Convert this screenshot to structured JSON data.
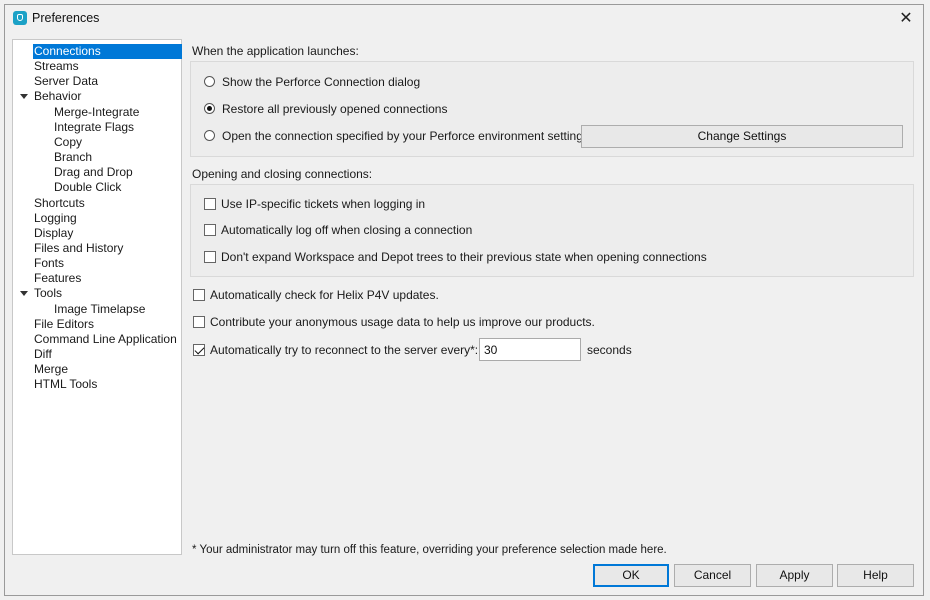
{
  "window": {
    "title": "Preferences",
    "close_glyph": "✕"
  },
  "sidebar": {
    "items": [
      {
        "label": "Connections",
        "level": 0,
        "selected": true
      },
      {
        "label": "Streams",
        "level": 0
      },
      {
        "label": "Server Data",
        "level": 0
      },
      {
        "label": "Behavior",
        "level": 0,
        "expanded": true
      },
      {
        "label": "Merge-Integrate",
        "level": 1
      },
      {
        "label": "Integrate Flags",
        "level": 1
      },
      {
        "label": "Copy",
        "level": 1
      },
      {
        "label": "Branch",
        "level": 1
      },
      {
        "label": "Drag and Drop",
        "level": 1
      },
      {
        "label": "Double Click",
        "level": 1
      },
      {
        "label": "Shortcuts",
        "level": 0
      },
      {
        "label": "Logging",
        "level": 0
      },
      {
        "label": "Display",
        "level": 0
      },
      {
        "label": "Files and History",
        "level": 0
      },
      {
        "label": "Fonts",
        "level": 0
      },
      {
        "label": "Features",
        "level": 0
      },
      {
        "label": "Tools",
        "level": 0,
        "expanded": true
      },
      {
        "label": "Image Timelapse",
        "level": 1
      },
      {
        "label": "File Editors",
        "level": 0
      },
      {
        "label": "Command Line Application",
        "level": 0
      },
      {
        "label": "Diff",
        "level": 0
      },
      {
        "label": "Merge",
        "level": 0
      },
      {
        "label": "HTML Tools",
        "level": 0
      }
    ]
  },
  "launch": {
    "heading": "When the application launches:",
    "options": [
      {
        "label": "Show the Perforce Connection dialog",
        "checked": false
      },
      {
        "label": "Restore all previously opened connections",
        "checked": true
      },
      {
        "label": "Open the connection specified by your Perforce environment settings",
        "checked": false
      }
    ],
    "change_settings_label": "Change Settings"
  },
  "opening": {
    "heading": "Opening and closing connections:",
    "options": [
      {
        "label": "Use IP-specific tickets when logging in",
        "checked": false
      },
      {
        "label": "Automatically log off when closing a connection",
        "checked": false
      },
      {
        "label": "Don't expand Workspace and Depot trees to their previous state when opening connections",
        "checked": false
      }
    ]
  },
  "general": {
    "auto_check_updates_label": "Automatically check for Helix P4V updates.",
    "auto_check_updates_checked": false,
    "contribute_label": "Contribute your anonymous usage data to help us improve our products.",
    "contribute_checked": false,
    "reconnect_label": "Automatically try to reconnect to the server every*:",
    "reconnect_checked": true,
    "reconnect_value": "30",
    "reconnect_unit": "seconds"
  },
  "footnote": "* Your administrator may turn off this feature, overriding your preference selection made here.",
  "buttons": {
    "ok": "OK",
    "cancel": "Cancel",
    "apply": "Apply",
    "help": "Help"
  },
  "colors": {
    "selection": "#0078d7",
    "background": "#f0f0f0"
  }
}
